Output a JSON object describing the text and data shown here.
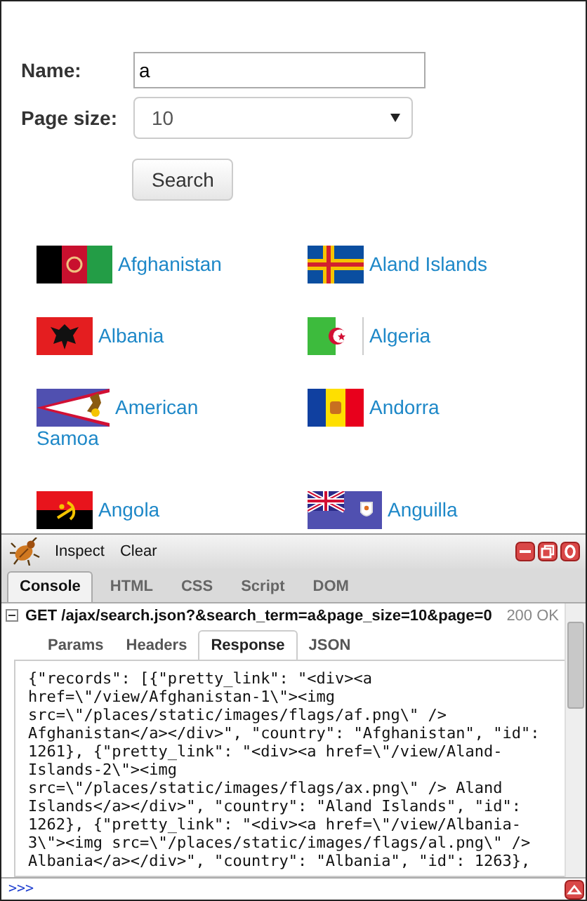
{
  "form": {
    "name_label": "Name:",
    "name_value": "a",
    "page_size_label": "Page size:",
    "page_size_value": "10",
    "search_button": "Search"
  },
  "results": [
    {
      "country": "Afghanistan",
      "kind": "af"
    },
    {
      "country": "Aland Islands",
      "kind": "ax"
    },
    {
      "country": "Albania",
      "kind": "al"
    },
    {
      "country": "Algeria",
      "kind": "dz"
    },
    {
      "country": "American Samoa",
      "kind": "as"
    },
    {
      "country": "Andorra",
      "kind": "ad"
    },
    {
      "country": "Angola",
      "kind": "ao"
    },
    {
      "country": "Anguilla",
      "kind": "ai"
    }
  ],
  "devtools": {
    "toolbar": [
      "Inspect",
      "Clear"
    ],
    "tabs": [
      {
        "label": "Console",
        "selected": true
      },
      {
        "label": "HTML",
        "selected": false
      },
      {
        "label": "CSS",
        "selected": false
      },
      {
        "label": "Script",
        "selected": false
      },
      {
        "label": "DOM",
        "selected": false
      }
    ],
    "request": {
      "expanded": true,
      "url": "GET /ajax/search.json?&search_term=a&page_size=10&page=0",
      "status": "200 OK"
    },
    "subtabs": [
      {
        "label": "Params",
        "selected": false
      },
      {
        "label": "Headers",
        "selected": false
      },
      {
        "label": "Response",
        "selected": true
      },
      {
        "label": "JSON",
        "selected": false
      }
    ],
    "response_lines": [
      "{\"records\": [{\"pretty_link\": \"<div><a",
      "href=\\\"/view/Afghanistan-1\\\"><img",
      "src=\\\"/places/static/images/flags/af.png\\\" />",
      "Afghanistan</a></div>\", \"country\": \"Afghanistan\", \"id\":",
      "1261}, {\"pretty_link\": \"<div><a href=\\\"/view/Aland-",
      "Islands-2\\\"><img",
      "src=\\\"/places/static/images/flags/ax.png\\\" /> Aland",
      "Islands</a></div>\", \"country\": \"Aland Islands\", \"id\":",
      "1262}, {\"pretty_link\": \"<div><a href=\\\"/view/Albania-",
      "3\\\"><img src=\\\"/places/static/images/flags/al.png\\\" />",
      "Albania</a></div>\", \"country\": \"Albania\", \"id\": 1263},"
    ],
    "prompt": ">>>"
  }
}
